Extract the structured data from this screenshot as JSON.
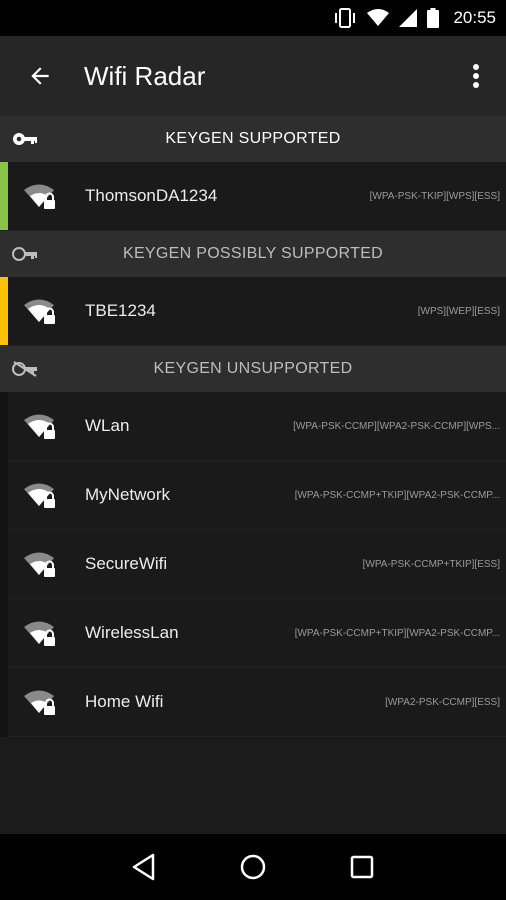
{
  "status_bar": {
    "time": "20:55",
    "icons": [
      "vibrate-icon",
      "wifi-signal-icon",
      "cell-signal-icon",
      "battery-icon"
    ]
  },
  "app_bar": {
    "title": "Wifi Radar",
    "back_icon": "arrow-back-icon",
    "menu_icon": "more-vert-icon"
  },
  "sections": {
    "supported": {
      "label": "KEYGEN SUPPORTED",
      "icon": "key-icon",
      "accent": "#8bc34a",
      "networks": [
        {
          "ssid": "ThomsonDA1234",
          "caps": "[WPA-PSK-TKIP][WPS][ESS]"
        }
      ]
    },
    "possible": {
      "label": "KEYGEN POSSIBLY SUPPORTED",
      "icon": "key-partial-icon",
      "accent": "#ffc107",
      "networks": [
        {
          "ssid": "TBE1234",
          "caps": "[WPS][WEP][ESS]"
        }
      ]
    },
    "unsupported": {
      "label": "KEYGEN UNSUPPORTED",
      "icon": "key-off-icon",
      "networks": [
        {
          "ssid": "WLan",
          "caps": "[WPA-PSK-CCMP][WPA2-PSK-CCMP][WPS..."
        },
        {
          "ssid": "MyNetwork",
          "caps": "[WPA-PSK-CCMP+TKIP][WPA2-PSK-CCMP..."
        },
        {
          "ssid": "SecureWifi",
          "caps": "[WPA-PSK-CCMP+TKIP][ESS]"
        },
        {
          "ssid": "WirelessLan",
          "caps": "[WPA-PSK-CCMP+TKIP][WPA2-PSK-CCMP..."
        },
        {
          "ssid": "Home Wifi",
          "caps": "[WPA2-PSK-CCMP][ESS]"
        }
      ]
    }
  },
  "nav_bar": {
    "icons": [
      "nav-back-icon",
      "nav-home-icon",
      "nav-recents-icon"
    ]
  }
}
